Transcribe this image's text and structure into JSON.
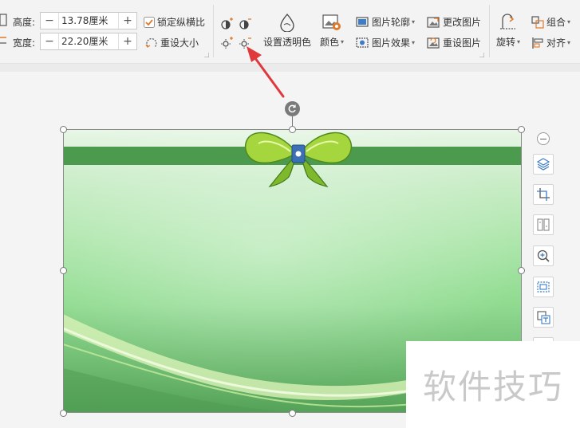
{
  "ribbon": {
    "height_label": "高度:",
    "width_label": "宽度:",
    "height_value": "13.78厘米",
    "width_value": "22.20厘米",
    "minus": "−",
    "plus": "+",
    "lock_ratio": "锁定纵横比",
    "lock_ratio_checked": true,
    "reset_size": "重设大小",
    "set_transparent": "设置透明色",
    "color": "颜色",
    "picture_outline": "图片轮廓",
    "picture_effects": "图片效果",
    "change_picture": "更改图片",
    "reset_picture": "重设图片",
    "rotate": "旋转",
    "group": "组合",
    "align": "对齐"
  },
  "watermark": "软件技巧",
  "colors": {
    "arrow": "#e0393c",
    "band": "#4c9a4e",
    "accent_icon": "#3d7cc9"
  },
  "icons": {
    "contrast_increase": "contrast-plus-icon",
    "contrast_decrease": "contrast-minus-icon",
    "brightness_increase": "brightness-plus-icon",
    "brightness_decrease": "brightness-minus-icon",
    "rotate_handle": "rotate-handle-icon"
  }
}
